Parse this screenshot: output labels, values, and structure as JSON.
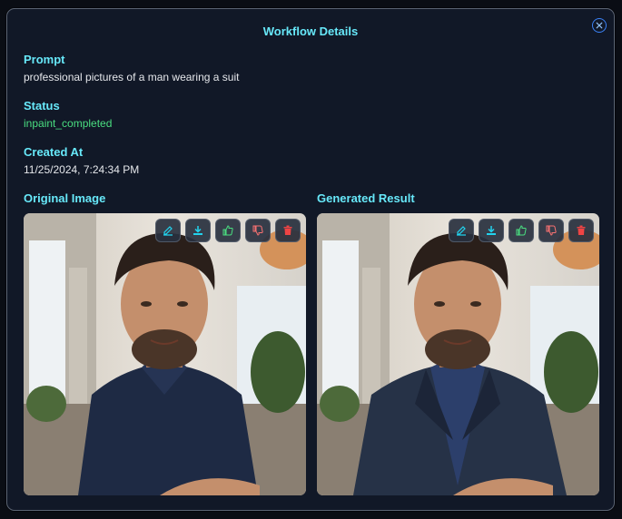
{
  "modal": {
    "title": "Workflow Details"
  },
  "fields": {
    "prompt_label": "Prompt",
    "prompt_value": "professional pictures of a man wearing a suit",
    "status_label": "Status",
    "status_value": "inpaint_completed",
    "created_label": "Created At",
    "created_value": "11/25/2024, 7:24:34 PM"
  },
  "images": {
    "original_label": "Original Image",
    "generated_label": "Generated Result"
  },
  "toolbar_icons": [
    "edit-icon",
    "download-icon",
    "thumbs-up-icon",
    "thumbs-down-icon",
    "trash-icon"
  ],
  "colors": {
    "accent": "#67e8f9",
    "status": "#4ade80",
    "edit": "#22d3ee",
    "download": "#22d3ee",
    "thumbs_up": "#4ade80",
    "thumbs_down": "#f87171",
    "trash": "#ef4444"
  }
}
